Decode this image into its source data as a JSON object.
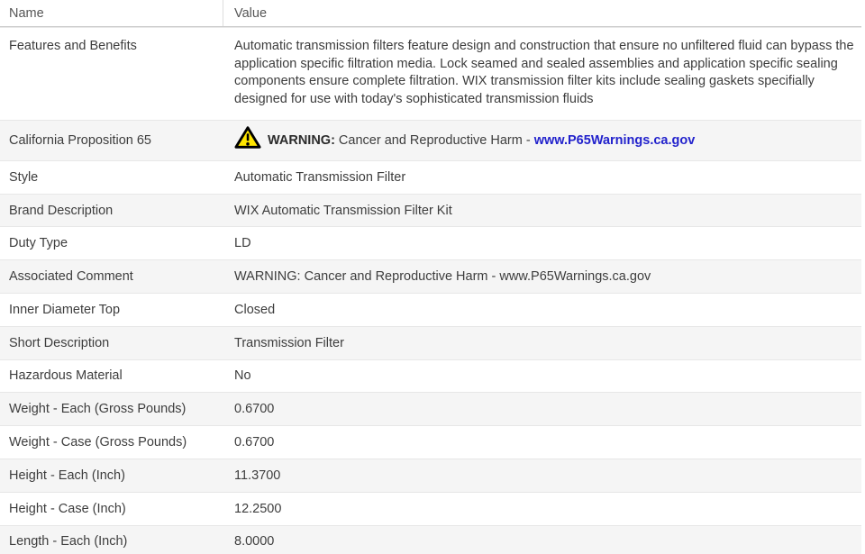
{
  "header": {
    "name_label": "Name",
    "value_label": "Value"
  },
  "colors": {
    "link_blue": "#2222cc",
    "warning_yellow": "#ffe500",
    "alt_row_bg": "#f5f5f5",
    "text": "#3d3d3d",
    "header_text": "#555555"
  },
  "prop65": {
    "icon": "warning-triangle-icon",
    "warning_label": "WARNING:",
    "text": "Cancer and Reproductive Harm -",
    "link_text": "www.P65Warnings.ca.gov"
  },
  "rows": [
    {
      "name": "Features and Benefits",
      "value": "Automatic transmission filters feature design and construction that ensure no unfiltered fluid can bypass the application specific filtration media. Lock seamed and sealed assemblies and application specific sealing components ensure complete filtration. WIX transmission filter kits include sealing gaskets specifially designed for use with today's sophisticated transmission fluids"
    },
    {
      "name": "California Proposition 65",
      "value": "WARNING: Cancer and Reproductive Harm - www.P65Warnings.ca.gov"
    },
    {
      "name": "Style",
      "value": "Automatic Transmission Filter"
    },
    {
      "name": "Brand Description",
      "value": "WIX Automatic Transmission Filter Kit"
    },
    {
      "name": "Duty Type",
      "value": "LD"
    },
    {
      "name": "Associated Comment",
      "value": "WARNING: Cancer and Reproductive Harm - www.P65Warnings.ca.gov"
    },
    {
      "name": "Inner Diameter Top",
      "value": "Closed"
    },
    {
      "name": "Short Description",
      "value": "Transmission Filter"
    },
    {
      "name": "Hazardous Material",
      "value": "No"
    },
    {
      "name": "Weight - Each (Gross Pounds)",
      "value": "0.6700"
    },
    {
      "name": "Weight - Case (Gross Pounds)",
      "value": "0.6700"
    },
    {
      "name": "Height - Each (Inch)",
      "value": "11.3700"
    },
    {
      "name": "Height - Case (Inch)",
      "value": "12.2500"
    },
    {
      "name": "Length - Each (Inch)",
      "value": "8.0000"
    }
  ]
}
